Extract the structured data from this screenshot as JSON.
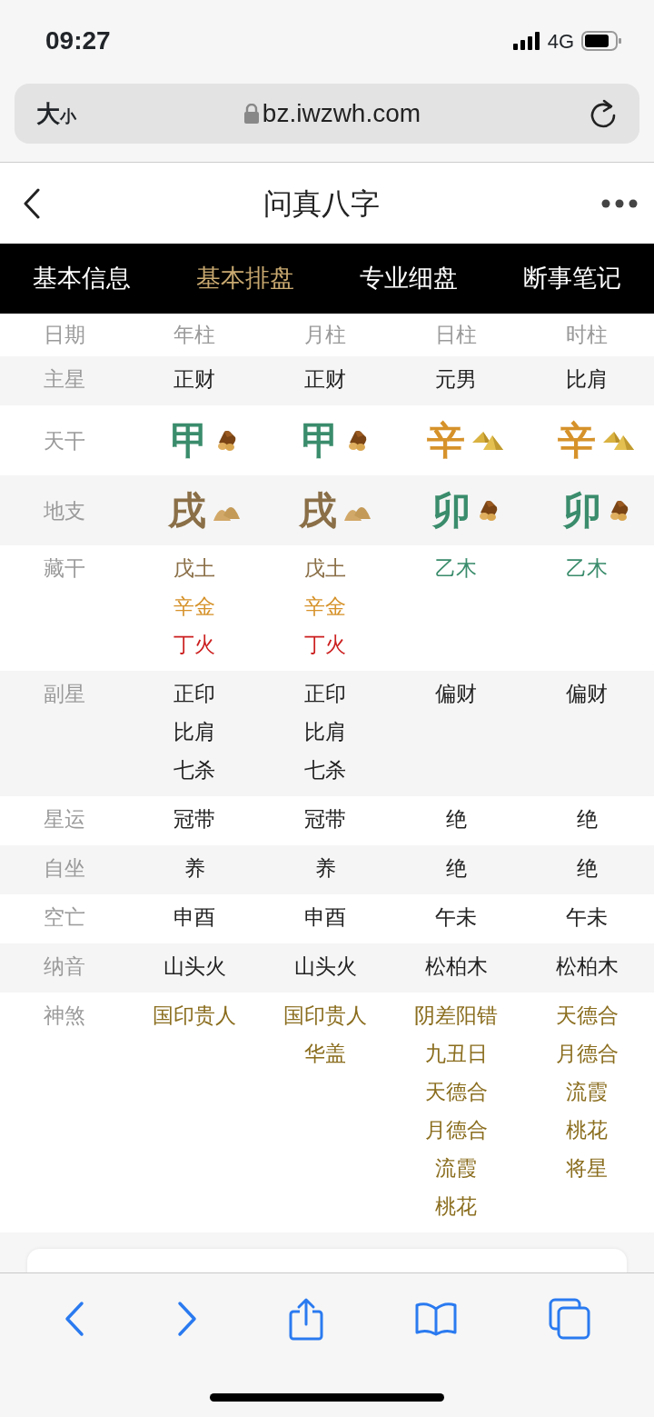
{
  "status_bar": {
    "time": "09:27",
    "network": "4G"
  },
  "address_bar": {
    "text_size_big": "大",
    "text_size_small": "小",
    "url": "bz.iwzwh.com"
  },
  "page_header": {
    "title": "问真八字"
  },
  "tabs": [
    {
      "label": "基本信息",
      "selected": false
    },
    {
      "label": "基本排盘",
      "selected": true
    },
    {
      "label": "专业细盘",
      "selected": false
    },
    {
      "label": "断事笔记",
      "selected": false
    }
  ],
  "chart": {
    "label_header": "日期",
    "columns": [
      "年柱",
      "月柱",
      "日柱",
      "时柱"
    ],
    "rows": [
      {
        "label": "主星",
        "kind": "text",
        "cells": [
          [
            {
              "text": "正财",
              "color": "#222222"
            }
          ],
          [
            {
              "text": "正财",
              "color": "#222222"
            }
          ],
          [
            {
              "text": "元男",
              "color": "#222222"
            }
          ],
          [
            {
              "text": "比肩",
              "color": "#222222"
            }
          ]
        ]
      },
      {
        "label": "天干",
        "kind": "glyph",
        "cells": [
          {
            "text": "甲",
            "color": "#3a8c6c",
            "kind": "wood"
          },
          {
            "text": "甲",
            "color": "#3a8c6c",
            "kind": "wood"
          },
          {
            "text": "辛",
            "color": "#d6922a",
            "kind": "metal"
          },
          {
            "text": "辛",
            "color": "#d6922a",
            "kind": "metal"
          }
        ]
      },
      {
        "label": "地支",
        "kind": "glyph",
        "cells": [
          {
            "text": "戌",
            "color": "#8a6f47",
            "kind": "earth"
          },
          {
            "text": "戌",
            "color": "#8a6f47",
            "kind": "earth"
          },
          {
            "text": "卯",
            "color": "#3a8c6c",
            "kind": "wood"
          },
          {
            "text": "卯",
            "color": "#3a8c6c",
            "kind": "wood"
          }
        ]
      },
      {
        "label": "藏干",
        "kind": "text",
        "cells": [
          [
            {
              "text": "戊土",
              "color": "#8a6f47"
            },
            {
              "text": "辛金",
              "color": "#d6922a"
            },
            {
              "text": "丁火",
              "color": "#cc1f1f"
            }
          ],
          [
            {
              "text": "戊土",
              "color": "#8a6f47"
            },
            {
              "text": "辛金",
              "color": "#d6922a"
            },
            {
              "text": "丁火",
              "color": "#cc1f1f"
            }
          ],
          [
            {
              "text": "乙木",
              "color": "#3a8c6c"
            }
          ],
          [
            {
              "text": "乙木",
              "color": "#3a8c6c"
            }
          ]
        ]
      },
      {
        "label": "副星",
        "kind": "text",
        "cells": [
          [
            {
              "text": "正印",
              "color": "#222222"
            },
            {
              "text": "比肩",
              "color": "#222222"
            },
            {
              "text": "七杀",
              "color": "#222222"
            }
          ],
          [
            {
              "text": "正印",
              "color": "#222222"
            },
            {
              "text": "比肩",
              "color": "#222222"
            },
            {
              "text": "七杀",
              "color": "#222222"
            }
          ],
          [
            {
              "text": "偏财",
              "color": "#222222"
            }
          ],
          [
            {
              "text": "偏财",
              "color": "#222222"
            }
          ]
        ]
      },
      {
        "label": "星运",
        "kind": "text",
        "cells": [
          [
            {
              "text": "冠带",
              "color": "#222222"
            }
          ],
          [
            {
              "text": "冠带",
              "color": "#222222"
            }
          ],
          [
            {
              "text": "绝",
              "color": "#222222"
            }
          ],
          [
            {
              "text": "绝",
              "color": "#222222"
            }
          ]
        ]
      },
      {
        "label": "自坐",
        "kind": "text",
        "cells": [
          [
            {
              "text": "养",
              "color": "#222222"
            }
          ],
          [
            {
              "text": "养",
              "color": "#222222"
            }
          ],
          [
            {
              "text": "绝",
              "color": "#222222"
            }
          ],
          [
            {
              "text": "绝",
              "color": "#222222"
            }
          ]
        ]
      },
      {
        "label": "空亡",
        "kind": "text",
        "cells": [
          [
            {
              "text": "申酉",
              "color": "#222222"
            }
          ],
          [
            {
              "text": "申酉",
              "color": "#222222"
            }
          ],
          [
            {
              "text": "午未",
              "color": "#222222"
            }
          ],
          [
            {
              "text": "午未",
              "color": "#222222"
            }
          ]
        ]
      },
      {
        "label": "纳音",
        "kind": "text",
        "cells": [
          [
            {
              "text": "山头火",
              "color": "#222222"
            }
          ],
          [
            {
              "text": "山头火",
              "color": "#222222"
            }
          ],
          [
            {
              "text": "松柏木",
              "color": "#222222"
            }
          ],
          [
            {
              "text": "松柏木",
              "color": "#222222"
            }
          ]
        ]
      },
      {
        "label": "神煞",
        "kind": "text",
        "cells": [
          [
            {
              "text": "国印贵人",
              "color": "#8a6d1e"
            }
          ],
          [
            {
              "text": "国印贵人",
              "color": "#8a6d1e"
            },
            {
              "text": "华盖",
              "color": "#8a6d1e"
            }
          ],
          [
            {
              "text": "阴差阳错",
              "color": "#8a6d1e"
            },
            {
              "text": "九丑日",
              "color": "#8a6d1e"
            },
            {
              "text": "天德合",
              "color": "#8a6d1e"
            },
            {
              "text": "月德合",
              "color": "#8a6d1e"
            },
            {
              "text": "流霞",
              "color": "#8a6d1e"
            },
            {
              "text": "桃花",
              "color": "#8a6d1e"
            }
          ],
          [
            {
              "text": "天德合",
              "color": "#8a6d1e"
            },
            {
              "text": "月德合",
              "color": "#8a6d1e"
            },
            {
              "text": "流霞",
              "color": "#8a6d1e"
            },
            {
              "text": "桃花",
              "color": "#8a6d1e"
            },
            {
              "text": "将星",
              "color": "#8a6d1e"
            }
          ]
        ]
      }
    ]
  }
}
